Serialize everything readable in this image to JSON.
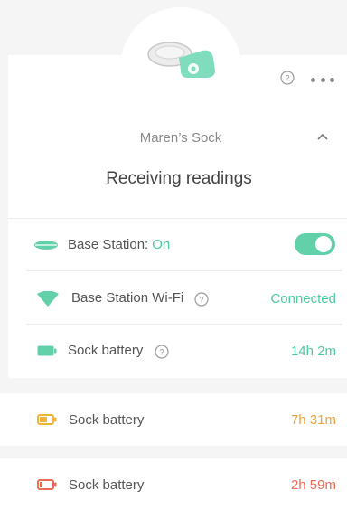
{
  "device": {
    "name": "Maren’s Sock",
    "status": "Receiving readings"
  },
  "base_station": {
    "label": "Base Station:",
    "state": "On",
    "toggle_on": true
  },
  "wifi": {
    "label": "Base Station Wi-Fi",
    "value": "Connected"
  },
  "battery_rows": [
    {
      "label": "Sock battery",
      "value": "14h 2m",
      "level": "full",
      "color": "#4ccaa0"
    },
    {
      "label": "Sock battery",
      "value": "7h 31m",
      "level": "half",
      "color": "#f0a23a"
    },
    {
      "label": "Sock battery",
      "value": "2h 59m",
      "level": "low",
      "color": "#ec6b55"
    }
  ],
  "icons": {
    "help": "help-circle-icon",
    "more": "more-horizontal-icon",
    "collapse": "chevron-up-icon",
    "base_station": "base-station-icon",
    "wifi": "wifi-icon",
    "battery": "battery-icon"
  },
  "colors": {
    "accent_green": "#4ccaa0",
    "warning_orange": "#f0a23a",
    "alert_red": "#ec6b55"
  }
}
